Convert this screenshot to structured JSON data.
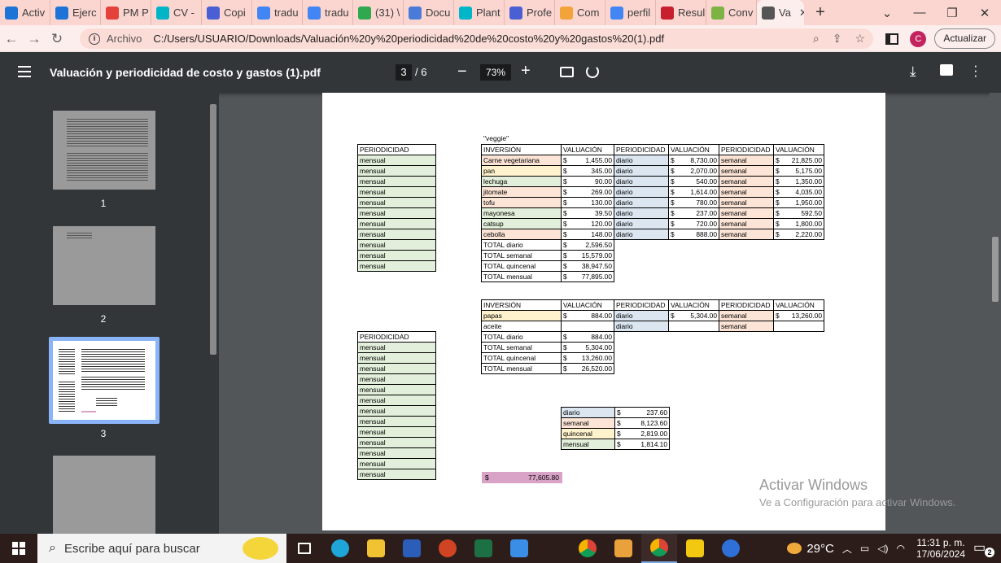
{
  "tabs": [
    {
      "label": "Activ",
      "color": "#1e73d6"
    },
    {
      "label": "Ejerc",
      "color": "#1e73d6"
    },
    {
      "label": "PM P",
      "color": "#e3413a"
    },
    {
      "label": "CV -",
      "color": "#00b5c8"
    },
    {
      "label": "Copi",
      "color": "#4a5fd3"
    },
    {
      "label": "tradu",
      "color": "#4285f4"
    },
    {
      "label": "tradu",
      "color": "#4285f4"
    },
    {
      "label": "(31) \\",
      "color": "#2fa84f"
    },
    {
      "label": "Docu",
      "color": "#4a7bd8"
    },
    {
      "label": "Plant",
      "color": "#00b5c8"
    },
    {
      "label": "Profe",
      "color": "#4a5fd3"
    },
    {
      "label": "Com",
      "color": "#f2a33a"
    },
    {
      "label": "perfil",
      "color": "#4285f4"
    },
    {
      "label": "Resul",
      "color": "#c71f2d"
    },
    {
      "label": "Conv",
      "color": "#7cb342"
    },
    {
      "label": "Va",
      "color": "#555555",
      "active": true
    }
  ],
  "window": {
    "minimize": "—",
    "restore": "❐",
    "close": "✕",
    "tab_list": "⌄"
  },
  "address": {
    "label": "Archivo",
    "url": "C:/Users/USUARIO/Downloads/Valuación%20y%20periodicidad%20de%20costo%20y%20gastos%20(1).pdf",
    "profile_initial": "C",
    "update_label": "Actualizar"
  },
  "pdf": {
    "title": "Valuación y periodicidad de costo y gastos (1).pdf",
    "current_page": "3",
    "total_pages": "/ 6",
    "zoom": "73%"
  },
  "thumbs": [
    {
      "label": "1"
    },
    {
      "label": "2"
    },
    {
      "label": "3"
    }
  ],
  "sheet": {
    "veggie_label": "\"veggie\"",
    "periodicity_header": "PERIODICIDAD",
    "periodicity_a": [
      "mensual",
      "mensual",
      "mensual",
      "mensual",
      "mensual",
      "mensual",
      "mensual",
      "mensual",
      "mensual",
      "mensual",
      "mensual"
    ],
    "periodicity_b": [
      "mensual",
      "mensual",
      "mensual",
      "mensual",
      "mensual",
      "mensual",
      "mensual",
      "mensual",
      "mensual",
      "mensual",
      "mensual",
      "mensual",
      "mensual"
    ],
    "inv_headers": [
      "INVERSIÓN",
      "VALUACIÓN",
      "PERIODICIDAD",
      "VALUACIÓN",
      "PERIODICIDAD",
      "VALUACIÓN"
    ],
    "inv_rows": [
      {
        "item": "Carne vegetariana",
        "v1": "1,455.00",
        "p1": "diario",
        "v2": "8,730.00",
        "p2": "semanal",
        "v3": "21,825.00"
      },
      {
        "item": "pan",
        "v1": "345.00",
        "p1": "diario",
        "v2": "2,070.00",
        "p2": "semanal",
        "v3": "5,175.00"
      },
      {
        "item": "lechuga",
        "v1": "90.00",
        "p1": "diario",
        "v2": "540.00",
        "p2": "semanal",
        "v3": "1,350.00"
      },
      {
        "item": "jitomate",
        "v1": "269.00",
        "p1": "diario",
        "v2": "1,614.00",
        "p2": "semanal",
        "v3": "4,035.00"
      },
      {
        "item": "tofu",
        "v1": "130.00",
        "p1": "diario",
        "v2": "780.00",
        "p2": "semanal",
        "v3": "1,950.00"
      },
      {
        "item": "mayonesa",
        "v1": "39.50",
        "p1": "diario",
        "v2": "237.00",
        "p2": "semanal",
        "v3": "592.50"
      },
      {
        "item": "catsup",
        "v1": "120.00",
        "p1": "diario",
        "v2": "720.00",
        "p2": "semanal",
        "v3": "1,800.00"
      },
      {
        "item": "cebolla",
        "v1": "148.00",
        "p1": "diario",
        "v2": "888.00",
        "p2": "semanal",
        "v3": "2,220.00"
      }
    ],
    "totals1": [
      {
        "label": "TOTAL diario",
        "value": "2,596.50"
      },
      {
        "label": "TOTAL semanal",
        "value": "15,579.00"
      },
      {
        "label": "TOTAL quincenal",
        "value": "38,947.50"
      },
      {
        "label": "TOTAL mensual",
        "value": "77,895.00"
      }
    ],
    "inv2_rows": [
      {
        "item": "papas",
        "v1": "884.00",
        "p1": "diario",
        "v2": "5,304.00",
        "p2": "semanal",
        "v3": "13,260.00"
      },
      {
        "item": "aceite",
        "v1": "",
        "p1": "diario",
        "v2": "",
        "p2": "semanal",
        "v3": ""
      }
    ],
    "totals2": [
      {
        "label": "TOTAL diario",
        "value": "884.00"
      },
      {
        "label": "TOTAL semanal",
        "value": "5,304.00"
      },
      {
        "label": "TOTAL quincenal",
        "value": "13,260.00"
      },
      {
        "label": "TOTAL mensual",
        "value": "26,520.00"
      }
    ],
    "summary": [
      {
        "label": "diario",
        "value": "237.60"
      },
      {
        "label": "semanal",
        "value": "8,123.60"
      },
      {
        "label": "quincenal",
        "value": "2,819.00"
      },
      {
        "label": "mensual",
        "value": "1,814.10"
      }
    ],
    "currency": "$",
    "grand_total": "77,605.80"
  },
  "watermark": {
    "line1": "Activar Windows",
    "line2": "Ve a Configuración para activar Windows."
  },
  "taskbar": {
    "search_placeholder": "Escribe aquí para buscar",
    "temp": "29°C",
    "time": "11:31 p. m.",
    "date": "17/06/2024",
    "notifications": "2"
  }
}
